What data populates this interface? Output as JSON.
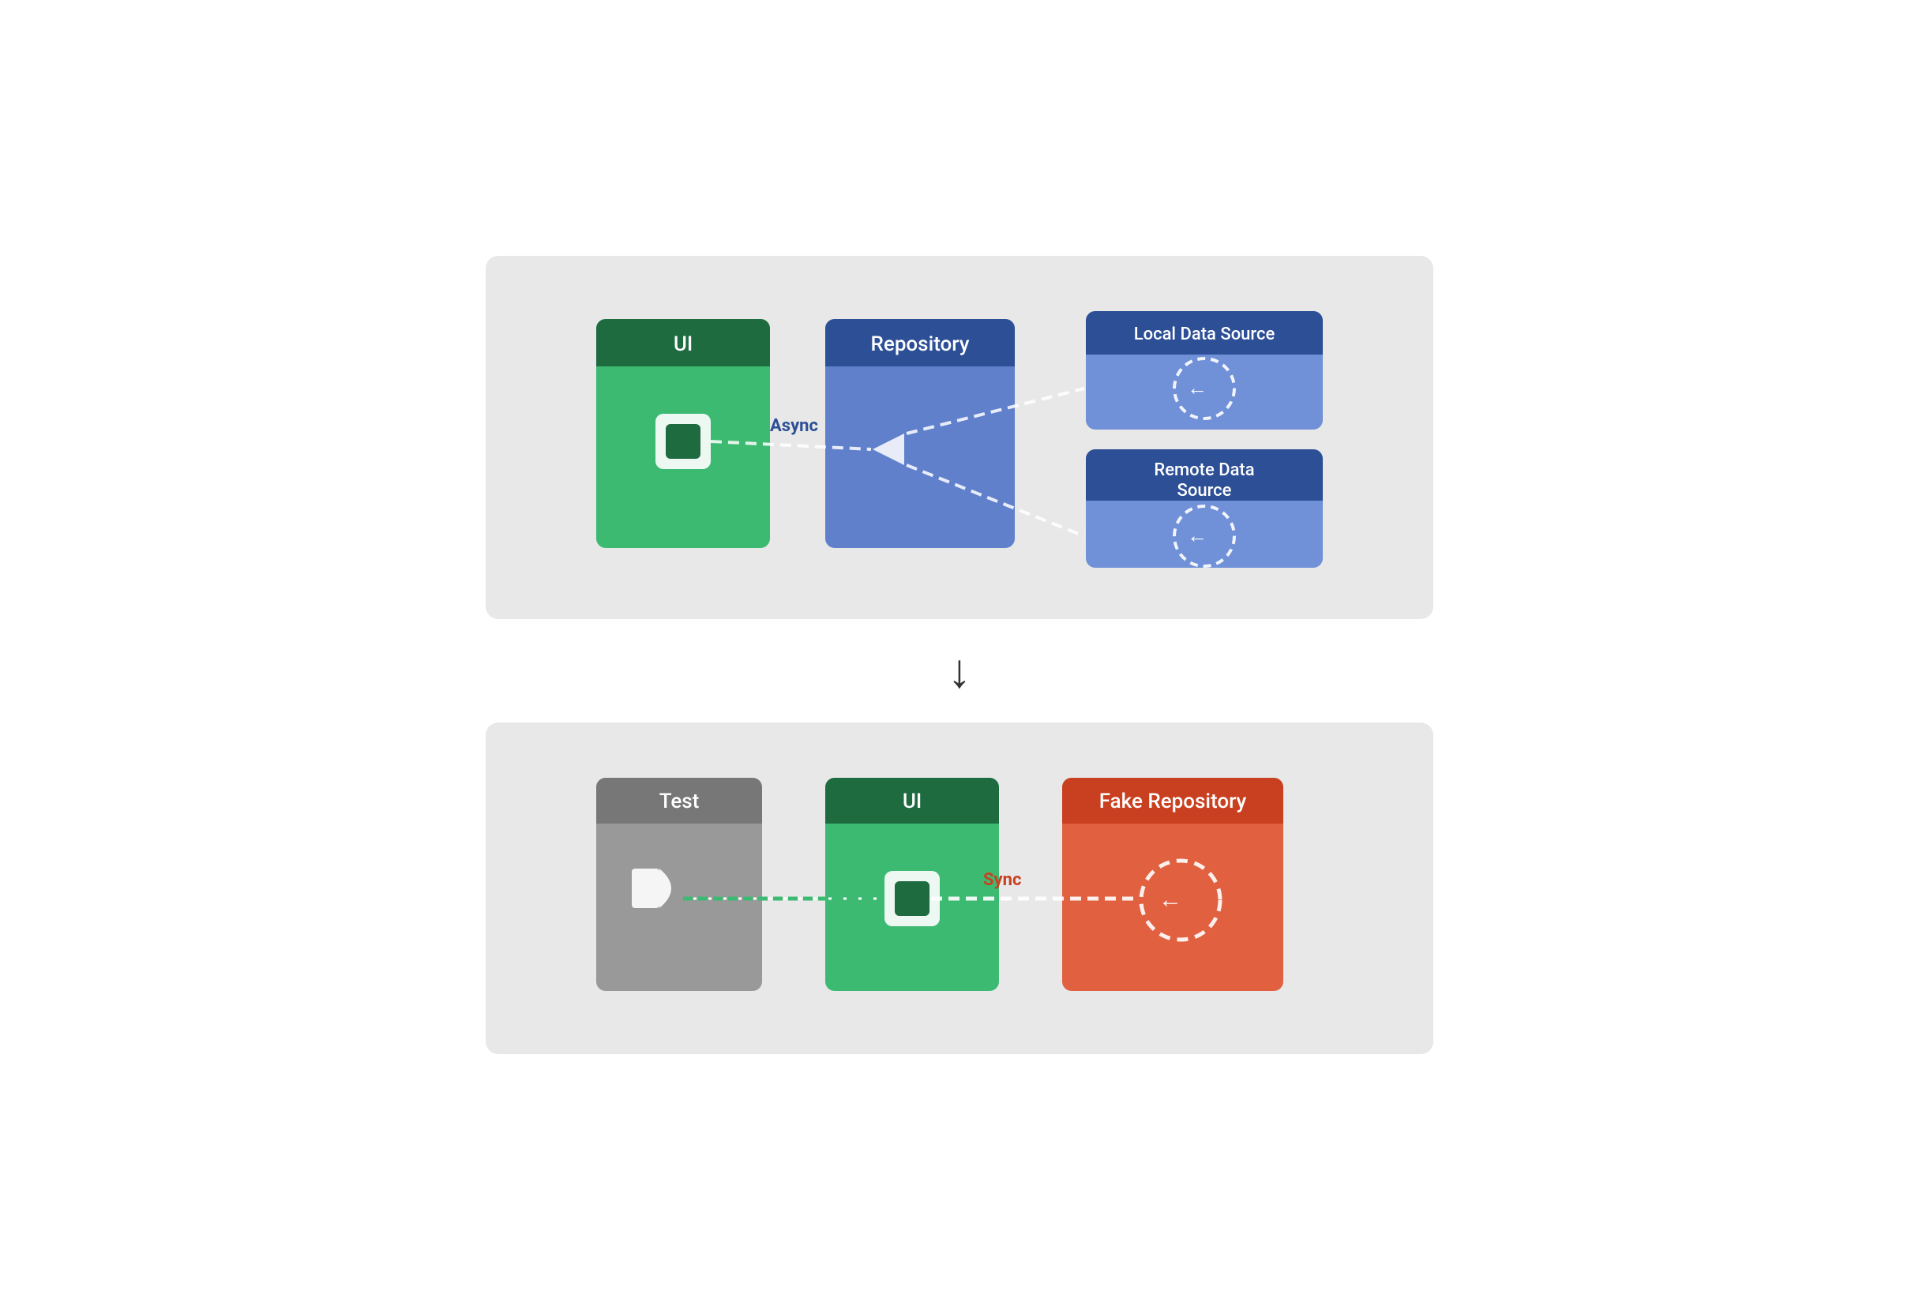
{
  "top_diagram": {
    "ui_label": "UI",
    "repo_label": "Repository",
    "local_ds_label": "Local Data Source",
    "remote_ds_label": "Remote Data Source",
    "async_label": "Async",
    "colors": {
      "ui_header": "#1e6b40",
      "ui_body": "#3dba72",
      "repo_header": "#2d4f96",
      "repo_body": "#6080cc",
      "local_header": "#2d4f96",
      "local_body": "#7090d8",
      "remote_header": "#2d4f96",
      "remote_body": "#7090d8"
    }
  },
  "bottom_diagram": {
    "test_label": "Test",
    "ui_label": "UI",
    "fake_repo_label": "Fake Repository",
    "sync_label": "Sync",
    "colors": {
      "test_header": "#777777",
      "test_body": "#999999",
      "ui_header": "#1e6b40",
      "ui_body": "#3dba72",
      "fake_header": "#c94020",
      "fake_body": "#e06040"
    }
  },
  "arrow_down_char": "↓"
}
